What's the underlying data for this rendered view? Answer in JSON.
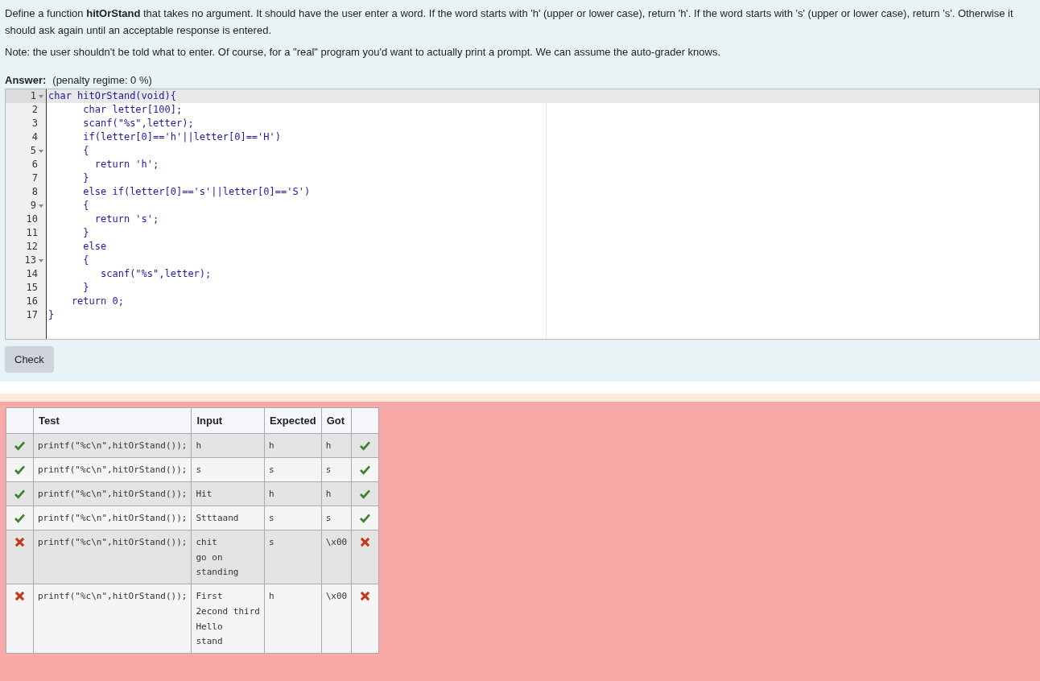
{
  "question": {
    "paragraphs": [
      "Define a function **hitOrStand** that takes no argument. It should have the user enter a word. If the word starts with 'h' (upper or lower case), return 'h'. If the word starts with 's' (upper or lower case), return 's'. Otherwise it should ask again until an acceptable response is entered.",
      "Note: the user shouldn't be told what to enter. Of course, for a \"real\" program you'd want to actually print a prompt. We can assume the auto-grader knows."
    ]
  },
  "answer": {
    "label": "Answer:",
    "penalty": "(penalty regime: 0 %)"
  },
  "editor": {
    "lines": [
      {
        "number": "1",
        "fold": true,
        "active": true,
        "code": "char hitOrStand(void){"
      },
      {
        "number": "2",
        "fold": false,
        "active": false,
        "code": "      char letter[100];"
      },
      {
        "number": "3",
        "fold": false,
        "active": false,
        "code": "      scanf(\"%s\",letter);"
      },
      {
        "number": "4",
        "fold": false,
        "active": false,
        "code": "      if(letter[0]=='h'||letter[0]=='H')"
      },
      {
        "number": "5",
        "fold": true,
        "active": false,
        "code": "      {"
      },
      {
        "number": "6",
        "fold": false,
        "active": false,
        "code": "        return 'h';"
      },
      {
        "number": "7",
        "fold": false,
        "active": false,
        "code": "      }"
      },
      {
        "number": "8",
        "fold": false,
        "active": false,
        "code": "      else if(letter[0]=='s'||letter[0]=='S')"
      },
      {
        "number": "9",
        "fold": true,
        "active": false,
        "code": "      {"
      },
      {
        "number": "10",
        "fold": false,
        "active": false,
        "code": "        return 's';"
      },
      {
        "number": "11",
        "fold": false,
        "active": false,
        "code": "      }"
      },
      {
        "number": "12",
        "fold": false,
        "active": false,
        "code": "      else"
      },
      {
        "number": "13",
        "fold": true,
        "active": false,
        "code": "      {"
      },
      {
        "number": "14",
        "fold": false,
        "active": false,
        "code": "         scanf(\"%s\",letter);"
      },
      {
        "number": "15",
        "fold": false,
        "active": false,
        "code": "      }"
      },
      {
        "number": "16",
        "fold": false,
        "active": false,
        "code": "    return 0;"
      },
      {
        "number": "17",
        "fold": false,
        "active": false,
        "code": "}"
      }
    ]
  },
  "check_button": "Check",
  "results": {
    "columns": [
      "Test",
      "Input",
      "Expected",
      "Got"
    ],
    "rows": [
      {
        "passed": true,
        "test": "printf(\"%c\\n\",hitOrStand());",
        "input": [
          "h"
        ],
        "expected": "h",
        "got": "h"
      },
      {
        "passed": true,
        "test": "printf(\"%c\\n\",hitOrStand());",
        "input": [
          "s"
        ],
        "expected": "s",
        "got": "s"
      },
      {
        "passed": true,
        "test": "printf(\"%c\\n\",hitOrStand());",
        "input": [
          "Hit"
        ],
        "expected": "h",
        "got": "h"
      },
      {
        "passed": true,
        "test": "printf(\"%c\\n\",hitOrStand());",
        "input": [
          "Stttaand"
        ],
        "expected": "s",
        "got": "s"
      },
      {
        "passed": false,
        "test": "printf(\"%c\\n\",hitOrStand());",
        "input": [
          "chit",
          "go on",
          "standing"
        ],
        "expected": "s",
        "got": "\\x00"
      },
      {
        "passed": false,
        "test": "printf(\"%c\\n\",hitOrStand());",
        "input": [
          "First",
          "2econd third",
          "Hello",
          "stand"
        ],
        "expected": "h",
        "got": "\\x00"
      }
    ]
  }
}
